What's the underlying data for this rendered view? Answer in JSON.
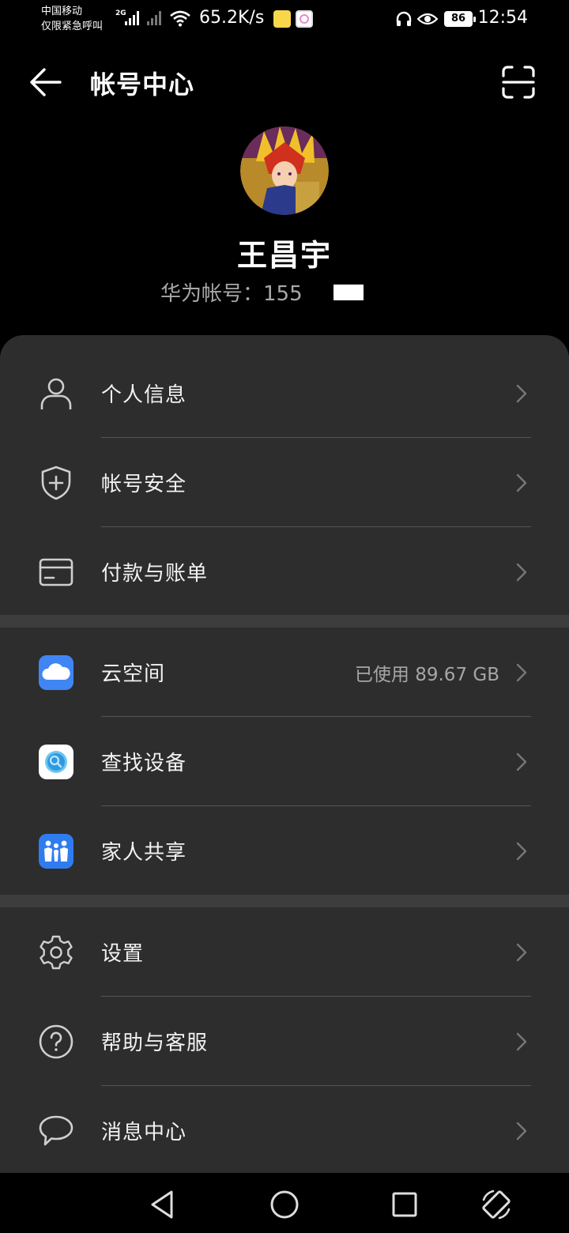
{
  "status_bar": {
    "carrier_line1": "中国移动",
    "carrier_line2": "仅限紧急呼叫",
    "network": "2G",
    "net_speed": "65.2K/s",
    "battery": "86",
    "time": "12:54"
  },
  "header": {
    "title": "帐号中心",
    "back_icon": "back-arrow-icon",
    "scan_icon": "scan-icon"
  },
  "profile": {
    "name": "王昌宇",
    "account_label": "华为帐号：",
    "account_number": "155"
  },
  "groups": [
    {
      "items": [
        {
          "label": "个人信息",
          "icon": "person-icon"
        },
        {
          "label": "帐号安全",
          "icon": "shield-icon"
        },
        {
          "label": "付款与账单",
          "icon": "card-icon"
        }
      ]
    },
    {
      "items": [
        {
          "label": "云空间",
          "icon": "cloud-icon",
          "value": "已使用 89.67 GB"
        },
        {
          "label": "查找设备",
          "icon": "find-device-icon"
        },
        {
          "label": "家人共享",
          "icon": "family-icon"
        }
      ]
    },
    {
      "items": [
        {
          "label": "设置",
          "icon": "gear-icon"
        },
        {
          "label": "帮助与客服",
          "icon": "help-icon"
        },
        {
          "label": "消息中心",
          "icon": "message-icon"
        }
      ]
    }
  ],
  "colors": {
    "background": "#000000",
    "sheet": "#2d2d2d",
    "divider": "#545454",
    "secondary_text": "#a8a8a8",
    "cloud_blue": "#3f86f4"
  }
}
